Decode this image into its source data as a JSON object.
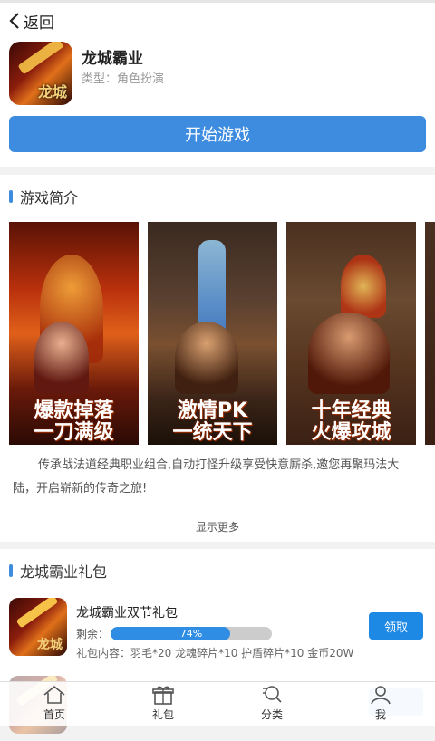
{
  "nav": {
    "back_label": "返回"
  },
  "app": {
    "icon_text": "龙城",
    "title": "龙城霸业",
    "type": "类型：角色扮演",
    "start_label": "开始游戏"
  },
  "intro": {
    "heading": "游戏简介",
    "screenshots": [
      {
        "caption_line1": "爆款掉落",
        "caption_line2": "一刀满级"
      },
      {
        "caption_line1": "激情PK",
        "caption_line2": "一统天下"
      },
      {
        "caption_line1": "十年经典",
        "caption_line2": "火爆攻城"
      }
    ],
    "description": "传承战法道经典职业组合,自动打怪升级享受快意厮杀,邀您再聚玛法大陆，开启崭新的传奇之旅!",
    "show_more": "显示更多"
  },
  "gifts": {
    "heading": "龙城霸业礼包",
    "items": [
      {
        "name": "龙城霸业双节礼包",
        "remain_label": "剩余：",
        "progress": 74,
        "progress_text": "74%",
        "content": "礼包内容：羽毛*20 龙魂碎片*10 护盾碎片*10 金币20W",
        "button": "领取"
      }
    ]
  },
  "tabbar": {
    "tabs": [
      {
        "label": "首页",
        "icon": "home-icon"
      },
      {
        "label": "礼包",
        "icon": "gift-icon"
      },
      {
        "label": "分类",
        "icon": "search-icon"
      },
      {
        "label": "我",
        "icon": "user-icon"
      }
    ]
  },
  "colors": {
    "accent": "#3d8ce0",
    "button": "#1e88e5",
    "progress": "#2f8de4"
  }
}
